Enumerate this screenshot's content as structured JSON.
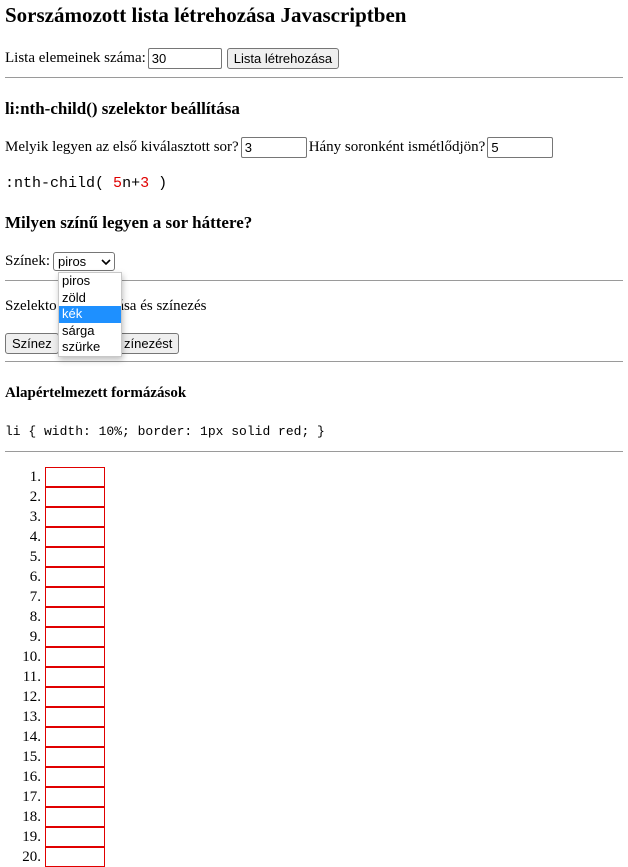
{
  "title": "Sorszámozott lista létrehozása Javascriptben",
  "count_row": {
    "label": "Lista elemeinek száma:",
    "value": "30",
    "button": "Lista létrehozása"
  },
  "selector_section": {
    "heading": "li:nth-child() szelektor beállítása",
    "first_label": "Melyik legyen az első kiválasztott sor?",
    "first_value": "3",
    "repeat_label": "Hány soronként ismétlődjön?",
    "repeat_value": "5",
    "formula_prefix": ":nth-child(",
    "formula_a": "5",
    "formula_n_plus": "n+",
    "formula_b": "3",
    "formula_suffix": ")"
  },
  "color_section": {
    "heading": "Milyen színű legyen a sor háttere?",
    "label": "Színek:",
    "selected": "piros",
    "options": [
      "piros",
      "zöld",
      "kék",
      "sárga",
      "szürke"
    ],
    "highlighted_option": "kék"
  },
  "apply_section": {
    "label_visible_left": "Szelekto",
    "label_visible_right": "zása és színezés",
    "button_left_visible": "Színez",
    "button_right_visible": "zínezést"
  },
  "defaults_section": {
    "heading": "Alapértelmezett formázások",
    "code": "li { width: 10%; border: 1px solid red; }"
  },
  "list": {
    "items": [
      "1.",
      "2.",
      "3.",
      "4.",
      "5.",
      "6.",
      "7.",
      "8.",
      "9.",
      "10.",
      "11.",
      "12.",
      "13.",
      "14.",
      "15.",
      "16.",
      "17.",
      "18.",
      "19.",
      "20."
    ],
    "border_color": "#e00000"
  },
  "colors": {
    "highlight": "#1e90ff",
    "accent_red": "#e00000"
  }
}
